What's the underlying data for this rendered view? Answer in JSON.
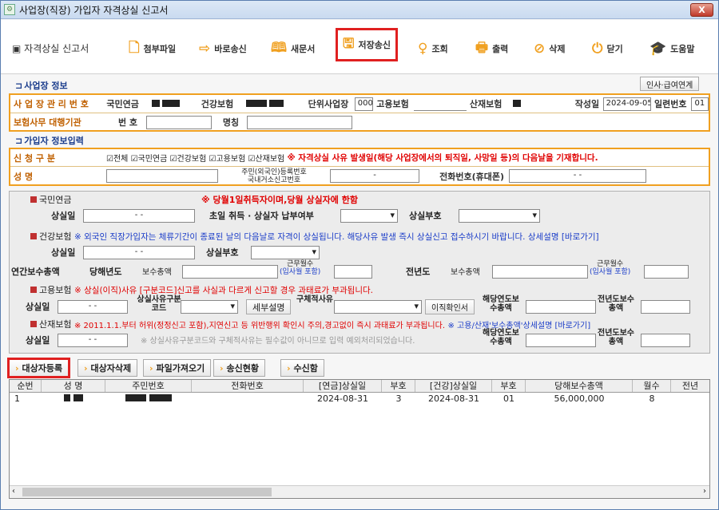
{
  "window": {
    "title": "사업장(직장) 가입자 자격상실 신고서",
    "close": "X"
  },
  "toolbar": {
    "title": "자격상실 신고서",
    "buttons": [
      {
        "label": "첨부파일",
        "icon": "attach-icon"
      },
      {
        "label": "바로송신",
        "icon": "arrow-right-icon"
      },
      {
        "label": "새문서",
        "icon": "book-icon"
      },
      {
        "label": "저장송신",
        "icon": "save-icon"
      },
      {
        "label": "조회",
        "icon": "lightbulb-icon"
      },
      {
        "label": "출력",
        "icon": "printer-icon"
      },
      {
        "label": "삭제",
        "icon": "delete-icon"
      },
      {
        "label": "닫기",
        "icon": "power-icon"
      },
      {
        "label": "도움말",
        "icon": "graduation-cap-icon"
      }
    ]
  },
  "workplace": {
    "section": "사업장 정보",
    "link_btn": "인사·급여연계",
    "mgmt_no_label": "사 업 장 관 리 번 호",
    "pension_label": "국민연금",
    "health_label": "건강보험",
    "unit_label": "단위사업장",
    "unit_value": "000",
    "employ_label": "고용보험",
    "accident_label": "산재보험",
    "date_label": "작성일",
    "date_value": "2024-09-05",
    "serial_label": "일련번호",
    "serial_value": "01",
    "agency_label": "보험사무 대행기관",
    "agency_no_label": "번 호",
    "agency_name_label": "명칭"
  },
  "input": {
    "section": "가입자 정보입력",
    "apply_label": "신 청 구 분",
    "checks": [
      "전체",
      "국민연금",
      "건강보험",
      "고용보험",
      "산재보험"
    ],
    "notice": "※ 자격상실 사유 발생일(해당 사업장에서의 퇴직일, 사망일 등)의 다음날을 기재합니다.",
    "name_label": "성 명",
    "id_label1": "주민(외국인)등록번호",
    "id_label2": "국내거소신고번호",
    "id_value": "-",
    "phone_label": "전화번호(휴대폰)",
    "phone_value": "-          -"
  },
  "pension": {
    "title": "국민연금",
    "notice": "※ 당월1일취득자이며,당월 상실자에 한함",
    "loss_date_label": "상실일",
    "loss_date_value": "-  -",
    "pay_label": "초일 취득 · 상실자 납부여부",
    "code_label": "상실부호"
  },
  "health": {
    "title": "건강보험",
    "notice": "※ 외국인 직장가입자는 체류기간이 종료된 날의 다음날로 자격이 상실됩니다. 해당사유 발생 즉시 상실신고 접수하시기 바랍니다. 상세설명 [바로가기]",
    "loss_date_label": "상실일",
    "loss_date_value": "-  -",
    "code_label": "상실부호",
    "annual_label": "연간보수총액",
    "cur_year_label": "당해년도",
    "pay_total_label": "보수총액",
    "months_label": "근무월수",
    "months_sub": "(입사월 포함)",
    "prev_year_label": "전년도"
  },
  "employment": {
    "title": "고용보험",
    "notice": "※ 상실(이직)사유 [구분코드]신고를 사실과 다르게 신고할 경우 과태료가 부과됩니다.",
    "loss_date_label": "상실일",
    "loss_date_value": "-  -",
    "reason_code_label": "상실사유구분코드",
    "detail_btn": "세부설명",
    "concrete_label": "구체적사유",
    "cert_btn": "이직확인서",
    "cur_pay_label": "해당연도보수총액",
    "prev_pay_label": "전년도보수총액"
  },
  "accident": {
    "title": "산재보험",
    "notice": "※ 2011.1.1.부터 허위(정정신고 포함),지연신고 등 위반행위 확인시 주의,경고없이 즉시 과태료가 부과됩니다.",
    "notice2": "※ 고용/산재'보수총액'상세설명 [바로가기]",
    "loss_date_label": "상실일",
    "loss_date_value": "-  -",
    "hint": "※ 상실사유구분코드와 구체적사유는 필수값이 아니므로 입력 예외처리되었습니다.",
    "cur_pay_label": "해당연도보수총액",
    "prev_pay_label": "전년도보수총액"
  },
  "actions": [
    "대상자등록",
    "대상자삭제",
    "파일가져오기",
    "송신현황",
    "수신함"
  ],
  "table": {
    "headers": [
      "순번",
      "성 명",
      "주민번호",
      "전화번호",
      "[연금]상실일",
      "부호",
      "[건강]상실일",
      "부호",
      "당해보수총액",
      "월수",
      "전년"
    ],
    "rows": [
      [
        "1",
        "",
        "",
        "",
        "2024-08-31",
        "3",
        "2024-08-31",
        "01",
        "56,000,000",
        "8",
        ""
      ]
    ]
  }
}
